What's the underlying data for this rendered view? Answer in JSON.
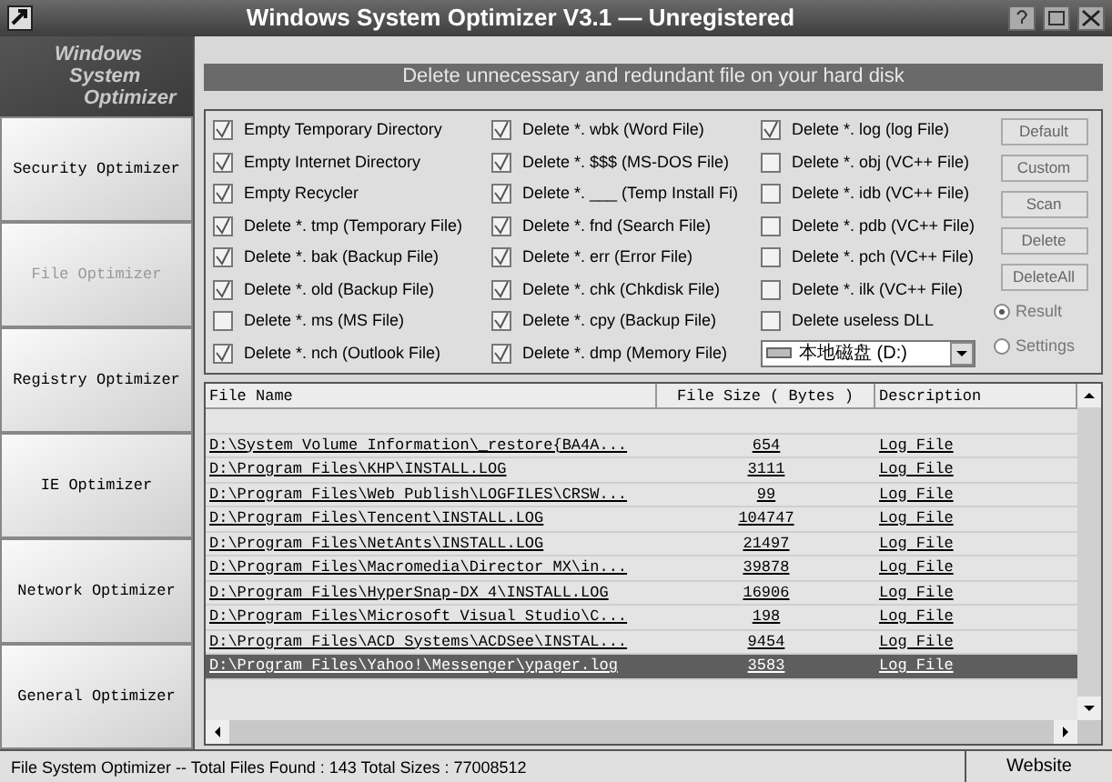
{
  "window": {
    "title": "Windows System Optimizer V3.1 — Unregistered"
  },
  "logo": {
    "lines": [
      "Windows",
      "System",
      "Optimizer"
    ]
  },
  "sidebar": {
    "items": [
      {
        "label": "Security Optimizer",
        "selected": false
      },
      {
        "label": "File Optimizer",
        "selected": true
      },
      {
        "label": "Registry Optimizer",
        "selected": false
      },
      {
        "label": "IE Optimizer",
        "selected": false
      },
      {
        "label": "Network Optimizer",
        "selected": false
      },
      {
        "label": "General Optimizer",
        "selected": false
      }
    ]
  },
  "banner": "Delete unnecessary and redundant file on your hard disk",
  "options": [
    [
      {
        "label": "Empty Temporary Directory",
        "checked": true
      },
      {
        "label": "Empty Internet Directory",
        "checked": true
      },
      {
        "label": "Empty Recycler",
        "checked": true
      },
      {
        "label": "Delete *. tmp (Temporary File)",
        "checked": true
      },
      {
        "label": "Delete *. bak (Backup File)",
        "checked": true
      },
      {
        "label": "Delete *. old (Backup File)",
        "checked": true
      },
      {
        "label": "Delete *. ms (MS File)",
        "checked": false
      },
      {
        "label": "Delete *. nch (Outlook File)",
        "checked": true
      }
    ],
    [
      {
        "label": "Delete *. wbk (Word File)",
        "checked": true
      },
      {
        "label": "Delete *. $$$ (MS-DOS File)",
        "checked": true
      },
      {
        "label": "Delete *. ___ (Temp Install Fi)",
        "checked": true
      },
      {
        "label": "Delete *. fnd (Search File)",
        "checked": true
      },
      {
        "label": "Delete *. err (Error File)",
        "checked": true
      },
      {
        "label": "Delete *. chk (Chkdisk File)",
        "checked": true
      },
      {
        "label": "Delete *. cpy (Backup File)",
        "checked": true
      },
      {
        "label": "Delete *. dmp (Memory File)",
        "checked": true
      }
    ],
    [
      {
        "label": "Delete *. log (log File)",
        "checked": true
      },
      {
        "label": "Delete *. obj (VC++ File)",
        "checked": false
      },
      {
        "label": "Delete *. idb (VC++ File)",
        "checked": false
      },
      {
        "label": "Delete *. pdb (VC++ File)",
        "checked": false
      },
      {
        "label": "Delete *. pch (VC++ File)",
        "checked": false
      },
      {
        "label": "Delete *. ilk  (VC++ File)",
        "checked": false
      },
      {
        "label": "Delete useless DLL",
        "checked": false
      }
    ]
  ],
  "drive": {
    "value": "本地磁盘 (D:)"
  },
  "buttons": [
    "Default",
    "Custom",
    "Scan",
    "Delete",
    "DeleteAll"
  ],
  "view": [
    {
      "label": "Result",
      "selected": true
    },
    {
      "label": "Settings",
      "selected": false
    }
  ],
  "table": {
    "columns": [
      "File Name",
      "File Size ( Bytes )",
      "Description"
    ],
    "rows": [
      {
        "cells": [
          "",
          "",
          ""
        ],
        "selected": false
      },
      {
        "cells": [
          "D:\\System Volume Information\\_restore{BA4A...",
          "654",
          "Log File"
        ],
        "selected": false
      },
      {
        "cells": [
          "D:\\Program Files\\KHP\\INSTALL.LOG",
          "3111",
          "Log File"
        ],
        "selected": false
      },
      {
        "cells": [
          "D:\\Program Files\\Web Publish\\LOGFILES\\CRSW...",
          "99",
          "Log File"
        ],
        "selected": false
      },
      {
        "cells": [
          "D:\\Program Files\\Tencent\\INSTALL.LOG",
          "104747",
          "Log File"
        ],
        "selected": false
      },
      {
        "cells": [
          "D:\\Program Files\\NetAnts\\INSTALL.LOG",
          "21497",
          "Log File"
        ],
        "selected": false
      },
      {
        "cells": [
          "D:\\Program Files\\Macromedia\\Director MX\\in...",
          "39878",
          "Log File"
        ],
        "selected": false
      },
      {
        "cells": [
          "D:\\Program Files\\HyperSnap-DX 4\\INSTALL.LOG",
          "16906",
          "Log File"
        ],
        "selected": false
      },
      {
        "cells": [
          "D:\\Program Files\\Microsoft Visual Studio\\C...",
          "198",
          "Log File"
        ],
        "selected": false
      },
      {
        "cells": [
          "D:\\Program Files\\ACD Systems\\ACDSee\\INSTAL...",
          "9454",
          "Log File"
        ],
        "selected": false
      },
      {
        "cells": [
          "D:\\Program Files\\Yahoo!\\Messenger\\ypager.log",
          "3583",
          "Log File"
        ],
        "selected": true
      }
    ]
  },
  "status_bar": {
    "text": "File System Optimizer -- Total Files Found : 143  Total Sizes : 77008512",
    "link": "Website"
  }
}
